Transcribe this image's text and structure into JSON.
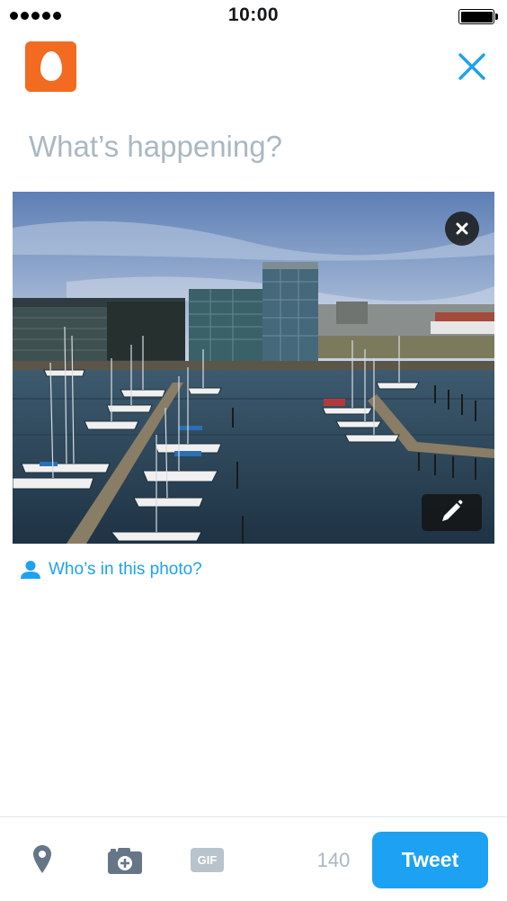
{
  "status_bar": {
    "time": "10:00",
    "signal_bars": 5,
    "battery_level": 1.0
  },
  "compose": {
    "placeholder": "What’s happening?",
    "value": ""
  },
  "photo": {
    "subject": "marina-with-sailboats-and-glass-office-buildings"
  },
  "tag_people": {
    "label": "Who’s in this photo?"
  },
  "toolbar": {
    "char_count": "140",
    "gif_label": "GIF",
    "tweet_label": "Tweet"
  },
  "colors": {
    "accent": "#1da1f2",
    "avatar_bg": "#f26b21",
    "placeholder": "#aab8c2",
    "icon_gray": "#657786",
    "disabled_gray": "#b9c3cb"
  },
  "icons": {
    "close": "close-icon",
    "remove_photo": "remove-photo-icon",
    "edit_photo": "pencil-icon",
    "tag_people": "person-icon",
    "location": "location-pin-icon",
    "camera": "camera-icon",
    "gif": "gif-icon"
  }
}
